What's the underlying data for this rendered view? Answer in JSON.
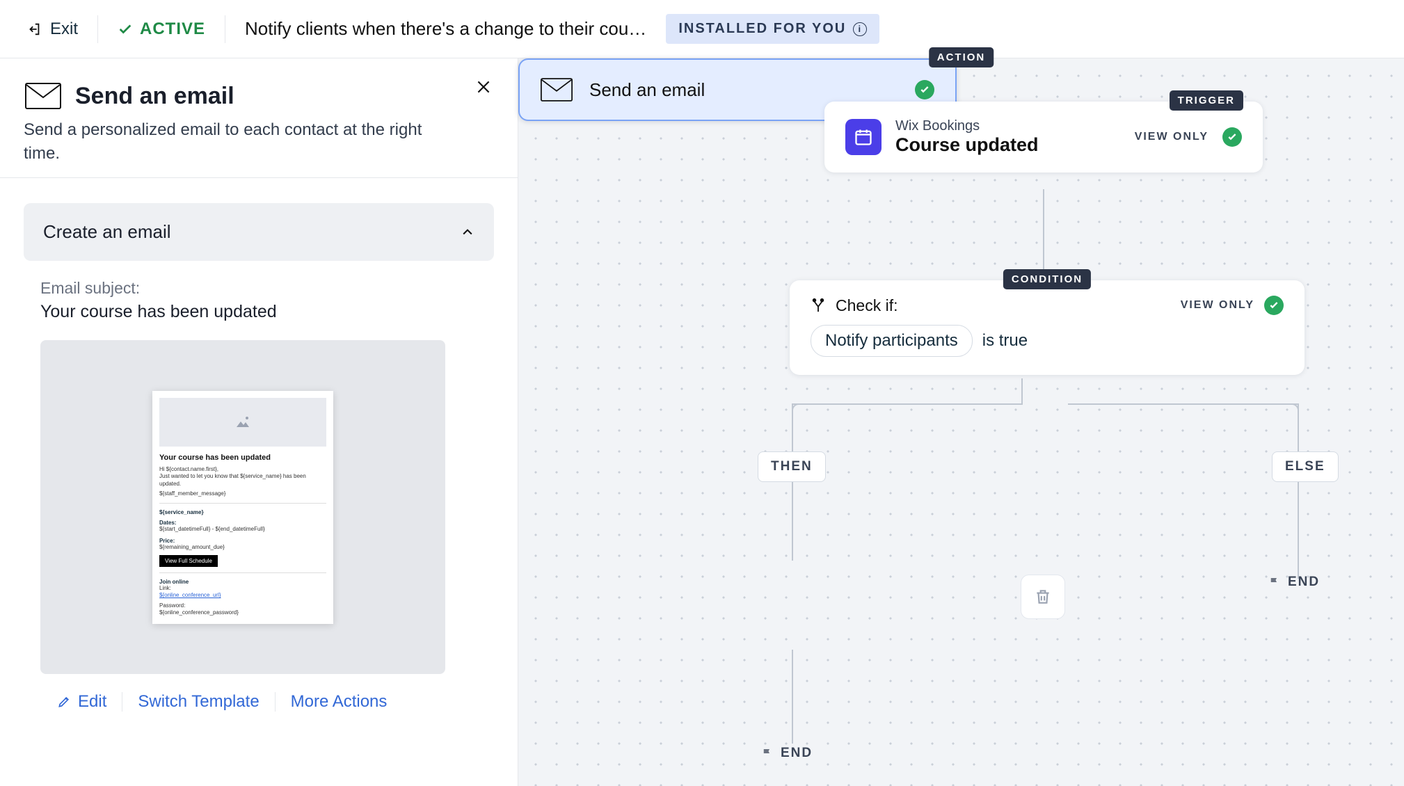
{
  "topbar": {
    "exit": "Exit",
    "status": "ACTIVE",
    "title": "Notify clients when there's a change to their cou…",
    "installed_badge": "INSTALLED FOR YOU"
  },
  "panel": {
    "title": "Send an email",
    "subtitle": "Send a personalized email to each contact at the right time.",
    "section_title": "Create an email",
    "subject_label": "Email subject:",
    "subject_value": "Your course has been updated",
    "actions": {
      "edit": "Edit",
      "switch": "Switch Template",
      "more": "More Actions"
    },
    "preview": {
      "heading": "Your course has been updated",
      "line1": "Hi ${contact.name.first},",
      "line2": "Just wanted to let you know that ${service_name} has been updated.",
      "line3": "${staff_member_message}",
      "service": "${service_name}",
      "dates_label": "Dates:",
      "dates_val": "${start_datetimeFull} - ${end_datetimeFull}",
      "price_label": "Price:",
      "price_val": "${remaining_amount_due}",
      "button": "View Full Schedule",
      "join_label": "Join online",
      "link_label": "Link:",
      "link_val": "${online_conference_url}",
      "pwd_label": "Password:",
      "pwd_val": "${online_conference_password}"
    }
  },
  "canvas": {
    "trigger": {
      "tag": "TRIGGER",
      "app": "Wix Bookings",
      "event": "Course updated",
      "viewonly": "VIEW ONLY"
    },
    "condition": {
      "tag": "CONDITION",
      "check_label": "Check if:",
      "chip": "Notify participants",
      "suffix": "is true",
      "viewonly": "VIEW ONLY"
    },
    "branches": {
      "then": "THEN",
      "else": "ELSE"
    },
    "action": {
      "tag": "ACTION",
      "label": "Send an email"
    },
    "end": "END"
  }
}
